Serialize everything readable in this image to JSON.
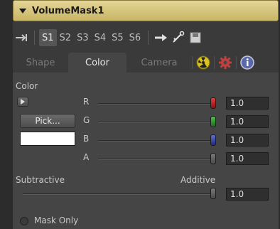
{
  "header": {
    "title": "VolumeMask1"
  },
  "toolbar": {
    "slots": [
      "S1",
      "S2",
      "S3",
      "S4",
      "S5",
      "S6"
    ]
  },
  "tabs": [
    {
      "label": "Shape",
      "active": false
    },
    {
      "label": "Color",
      "active": true
    },
    {
      "label": "Camera",
      "active": false
    }
  ],
  "color": {
    "section_label": "Color",
    "pick_label": "Pick...",
    "channels": [
      {
        "name": "R",
        "value": "1.0",
        "knob_color": "#b01818"
      },
      {
        "name": "G",
        "value": "1.0",
        "knob_color": "#2c8a2c"
      },
      {
        "name": "B",
        "value": "1.0",
        "knob_color": "#3040a0"
      },
      {
        "name": "A",
        "value": "1.0",
        "knob_color": "#6a6a6a"
      }
    ]
  },
  "blend": {
    "left_label": "Subtractive",
    "right_label": "Additive",
    "value": "1.0"
  },
  "mask_only": {
    "label": "Mask Only",
    "checked": false
  }
}
